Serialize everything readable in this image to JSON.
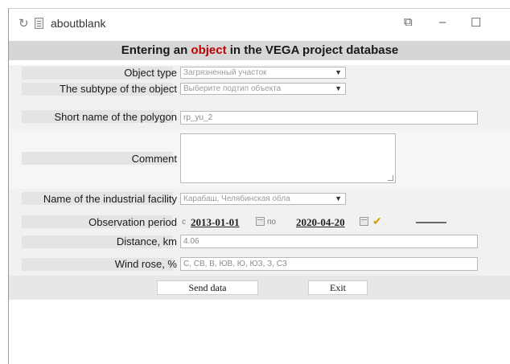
{
  "window": {
    "title": "aboutblank"
  },
  "header": {
    "prefix": "Entering an ",
    "highlight": "object",
    "suffix": " in the VEGA project database"
  },
  "form": {
    "object_type": {
      "label": "Object type",
      "value": "Загрязненный участок"
    },
    "subtype": {
      "label": "The subtype of the object",
      "value": "Выберите подтип объекта"
    },
    "short_name": {
      "label": "Short name of the polygon",
      "value": "rp_yu_2"
    },
    "comment": {
      "label": "Comment",
      "value": ""
    },
    "facility": {
      "label": "Name of the industrial facility",
      "value": "Карабаш, Челябинская обла"
    },
    "period": {
      "label": "Observation period",
      "from_prefix": "с",
      "from_date": "2013-01-01",
      "to_prefix": "по",
      "to_date": "2020-04-20"
    },
    "distance": {
      "label": "Distance, km",
      "value": "4.06"
    },
    "wind_rose": {
      "label": "Wind rose, %",
      "placeholder": "С, СВ, В, ЮВ, Ю, ЮЗ, З, СЗ"
    }
  },
  "buttons": {
    "send": "Send data",
    "exit": "Exit"
  },
  "icons": {
    "reload": "reload-icon",
    "file": "file-icon",
    "calendar": "calendar-icon",
    "check": "checkmark-icon"
  }
}
